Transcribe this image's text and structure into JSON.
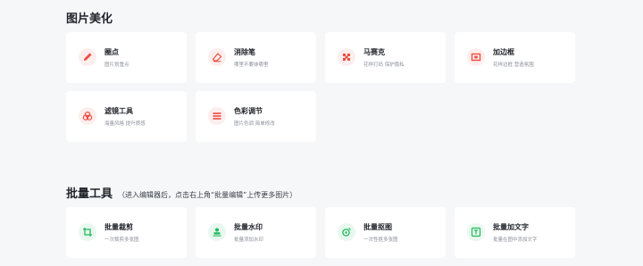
{
  "beautify": {
    "title": "图片美化",
    "items": [
      {
        "title": "圈点",
        "desc": "图片划重点",
        "icon": "pen-icon"
      },
      {
        "title": "消除笔",
        "desc": "哪里不要抹哪里",
        "icon": "eraser-icon"
      },
      {
        "title": "马赛克",
        "desc": "花样打码 保护隐私",
        "icon": "mosaic-icon"
      },
      {
        "title": "加边框",
        "desc": "花样边框 营造氛围",
        "icon": "frame-icon"
      },
      {
        "title": "滤镜工具",
        "desc": "海量风格 提升质感",
        "icon": "filter-icon"
      },
      {
        "title": "色彩调节",
        "desc": "图片色调 简单修改",
        "icon": "color-adjust-icon"
      }
    ]
  },
  "batch": {
    "title": "批量工具",
    "hint": "（进入编辑器后，点击右上角“批量编辑”上传更多图片）",
    "items": [
      {
        "title": "批量裁剪",
        "desc": "一次裁剪多张图",
        "icon": "crop-icon"
      },
      {
        "title": "批量水印",
        "desc": "批量添加水印",
        "icon": "watermark-icon"
      },
      {
        "title": "批量抠图",
        "desc": "一次性抠多张图",
        "icon": "cutout-icon"
      },
      {
        "title": "批量加文字",
        "desc": "批量在图中添加文字",
        "icon": "text-icon"
      }
    ]
  },
  "colors": {
    "accent_red": "#ee4d3f",
    "accent_green": "#1fb85c",
    "card_bg": "#ffffff",
    "page_bg": "#f6f7f9"
  }
}
